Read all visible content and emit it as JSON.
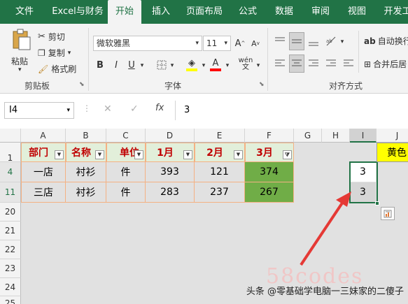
{
  "tabs": [
    "文件",
    "Excel与财务",
    "开始",
    "插入",
    "页面布局",
    "公式",
    "数据",
    "审阅",
    "视图",
    "开发工"
  ],
  "ribbon": {
    "paste": "粘贴",
    "cut": "剪切",
    "copy": "复制",
    "format_painter": "格式刷",
    "clipboard": "剪贴板",
    "font_name": "微软雅黑",
    "font_size": "11",
    "bold": "B",
    "italic": "I",
    "underline": "U",
    "font_group": "字体",
    "wrap": "自动换行",
    "merge": "合并后居",
    "align_group": "对齐方式",
    "a_up": "A",
    "a_down": "A",
    "wen": "wén"
  },
  "formula": {
    "name_box": "I4",
    "fx": "fx",
    "value": "3",
    "cancel": "✕",
    "confirm": "✓"
  },
  "columns": [
    "A",
    "B",
    "C",
    "D",
    "E",
    "F",
    "G",
    "H",
    "I",
    "J"
  ],
  "rows": [
    "1",
    "4",
    "11",
    "20",
    "21",
    "22",
    "23",
    "24",
    "25"
  ],
  "headers": [
    "部门",
    "名称",
    "单位",
    "1月",
    "2月",
    "3月"
  ],
  "data": [
    [
      "一店",
      "衬衫",
      "件",
      "393",
      "121",
      "374"
    ],
    [
      "三店",
      "衬衫",
      "件",
      "283",
      "237",
      "267"
    ]
  ],
  "side_values": [
    "3",
    "3"
  ],
  "j1": "黄色",
  "watermark": "头条 @零基础学电脑一三妹家的二傻子",
  "bg_wm": "58codes",
  "colors": {
    "green": "#217346",
    "header_fill": "#e2efda",
    "header_text": "#c00000",
    "highlight": "#70ad47",
    "yellow": "#ffff00",
    "arrow": "#e53935",
    "select_gray": "#d6d6d6"
  }
}
